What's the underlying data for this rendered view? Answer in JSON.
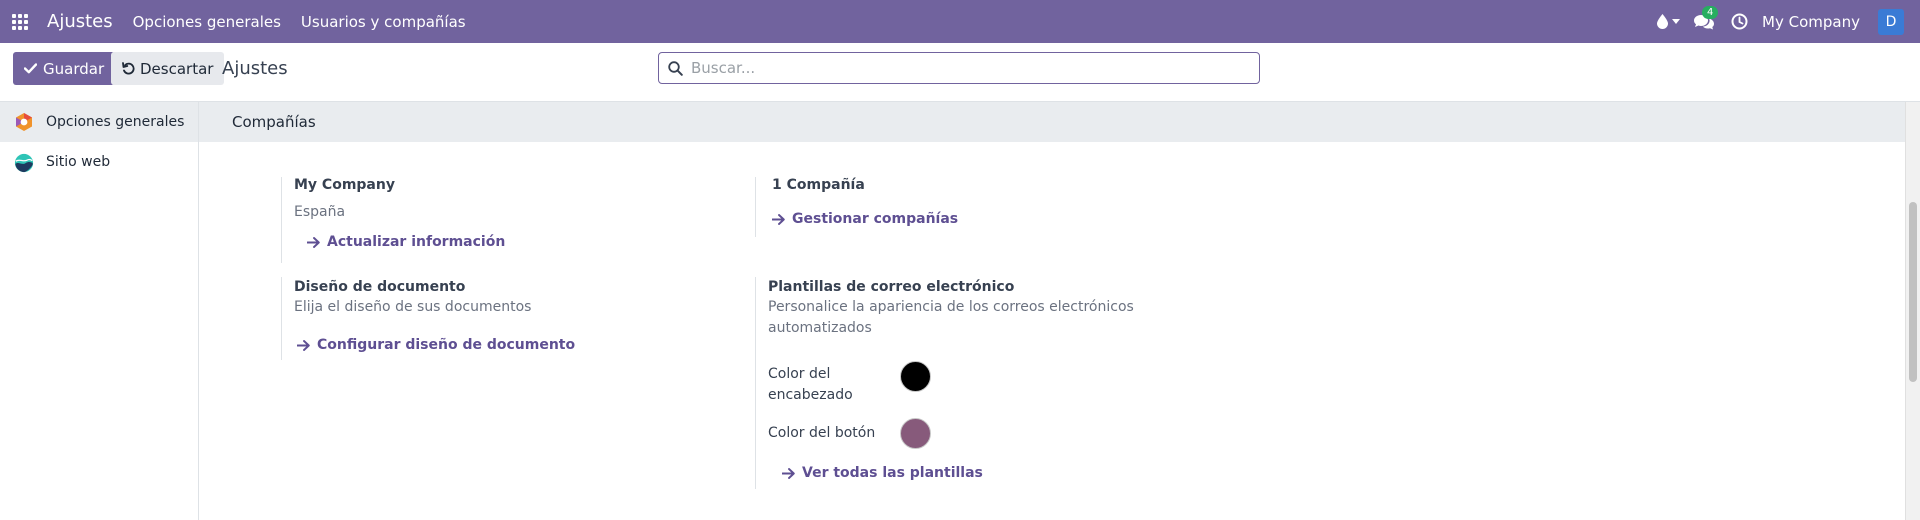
{
  "navbar": {
    "brand": "Ajustes",
    "menu": [
      "Opciones generales",
      "Usuarios y compañías"
    ],
    "messages_badge": "4",
    "company": "My Company",
    "avatar_letter": "D",
    "icons": [
      "apps-grid-icon",
      "drop-icon",
      "chat-icon",
      "clock-icon"
    ]
  },
  "control_panel": {
    "save_label": "Guardar",
    "discard_label": "Descartar",
    "title": "Ajustes",
    "search_placeholder": "Buscar..."
  },
  "sidebar": {
    "items": [
      {
        "label": "Opciones generales",
        "active": true
      },
      {
        "label": "Sitio web",
        "active": false
      }
    ]
  },
  "section": {
    "title": "Compañías",
    "company": {
      "name": "My Company",
      "country": "España",
      "link": "Actualizar información"
    },
    "companies": {
      "count_label": "1 Compañía",
      "link": "Gestionar compañías"
    },
    "document_layout": {
      "title": "Diseño de documento",
      "subtitle": "Elija el diseño de sus documentos",
      "link": "Configurar diseño de documento"
    },
    "email_templates": {
      "title": "Plantillas de correo electrónico",
      "subtitle_line1": "Personalice la apariencia de los correos electrónicos",
      "subtitle_line2": "automatizados",
      "header_color_label_line1": "Color del",
      "header_color_label_line2": "encabezado",
      "header_color": "#000000",
      "button_color_label": "Color del botón",
      "button_color": "#875a7b",
      "link": "Ver todas las plantillas"
    }
  },
  "colors": {
    "navbar": "#71639e",
    "link": "#5e4f92",
    "badge": "#27ae60",
    "avatar": "#3a7bd5"
  }
}
